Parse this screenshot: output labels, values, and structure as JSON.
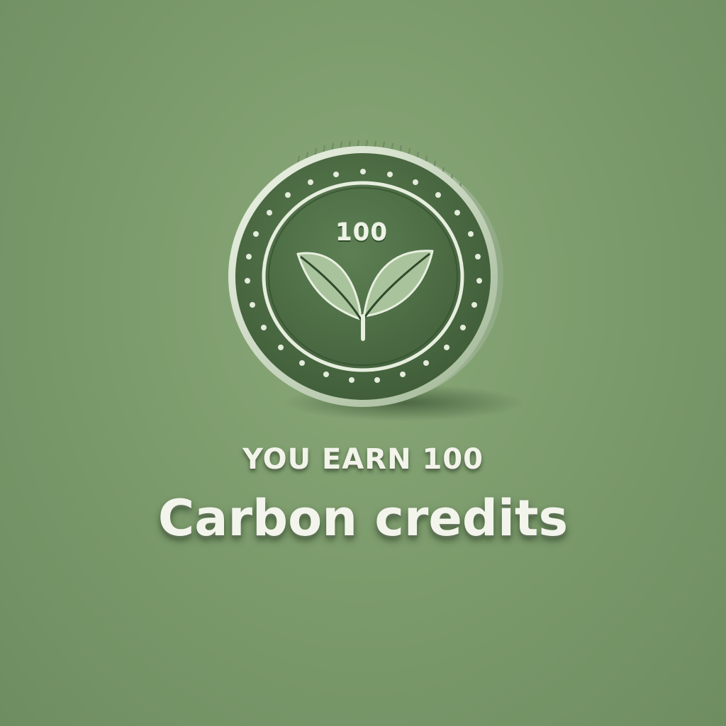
{
  "coin": {
    "value_label": "100",
    "icon": "leaf-sprout-icon"
  },
  "message": {
    "headline": "YOU EARN 100",
    "subline": "Carbon credits"
  },
  "colors": {
    "background": "#7d9c6d",
    "coin_face": "#4f7047",
    "coin_rim": "#d8e4cf",
    "leaf": "#a9c39c",
    "text": "#f2f4ea"
  }
}
